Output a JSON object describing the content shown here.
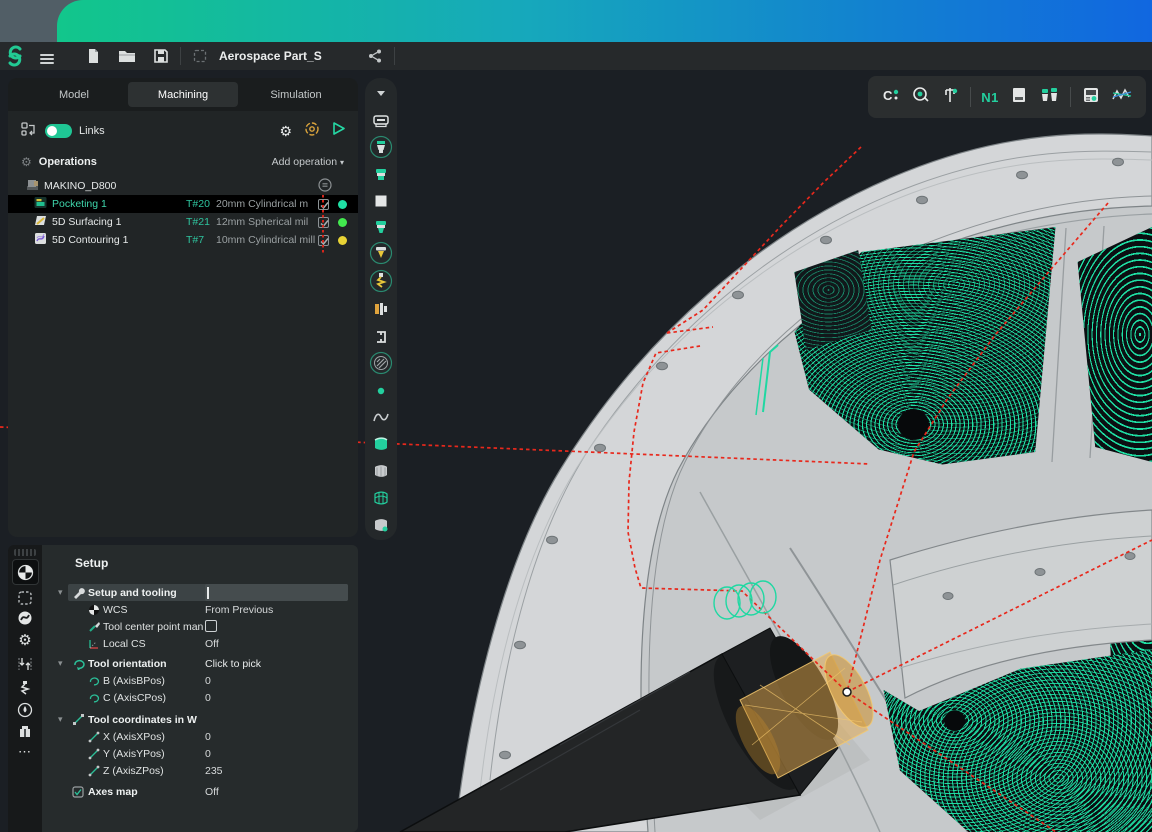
{
  "window": {
    "title": "Aerospace Part_S"
  },
  "topbar": {
    "icons": [
      "app-logo",
      "menu",
      "new-file",
      "open-folder",
      "save",
      "document-status",
      "share"
    ]
  },
  "tabs": {
    "items": [
      {
        "label": "Model"
      },
      {
        "label": "Machining"
      },
      {
        "label": "Simulation"
      }
    ],
    "active": "Machining"
  },
  "links": {
    "label": "Links",
    "enabled": true
  },
  "operations": {
    "header": "Operations",
    "add_button": "Add operation",
    "machine": "MAKINO_D800",
    "rows": [
      {
        "name": "Pocketing 1",
        "tool": "T#20",
        "description": "20mm Cylindrical m",
        "checked": true,
        "selected": true,
        "status_color": "#1fdfa4",
        "dot_style": "background:#1fdfa4"
      },
      {
        "name": "5D Surfacing 1",
        "tool": "T#21",
        "description": "12mm Spherical mil",
        "checked": true,
        "selected": false,
        "status_color": "#42e94e",
        "dot_style": "background:#42e94e"
      },
      {
        "name": "5D Contouring 1",
        "tool": "T#7",
        "description": "10mm Cylindrical mill",
        "checked": true,
        "selected": false,
        "status_color": "#e8d335",
        "dot_style": "background:#e8d335"
      }
    ]
  },
  "right_toolbar": {
    "nc_label": "N1",
    "icons": [
      "snap-magnet",
      "measure-tape",
      "caliper",
      "nc-program",
      "sheet-report",
      "tool-library",
      "machine-controller",
      "analysis-graph"
    ]
  },
  "mid_toolbar": {
    "icons": [
      "collapse-chevron",
      "stock-device",
      "tool-holder-circled",
      "tool-holder",
      "stock-square",
      "tool-teal",
      "drill-tip-circled",
      "drill-bit-circled",
      "clamp-fixture",
      "stock-bracket",
      "hatch-region-circled",
      "point-dot",
      "spline-curve",
      "surface-teal",
      "surface-gray",
      "surface-grid",
      "surface-point"
    ]
  },
  "setup_strip": {
    "icons": [
      "wcs",
      "stock-selection",
      "turning",
      "settings-gear",
      "travel-limits",
      "drill",
      "coolant",
      "tool-holder-block",
      "more"
    ]
  },
  "setup": {
    "title": "Setup",
    "groups": [
      {
        "label": "Setup and tooling",
        "value": "",
        "rows": [
          {
            "label": "WCS",
            "value": "From Previous"
          },
          {
            "label": "Tool center point man",
            "value": "",
            "checkbox": false
          },
          {
            "label": "Local CS",
            "value": "Off"
          }
        ]
      },
      {
        "label": "Tool orientation",
        "value": "Click to pick",
        "rows": [
          {
            "label": "B (AxisBPos)",
            "value": "0"
          },
          {
            "label": "C (AxisCPos)",
            "value": "0"
          }
        ]
      },
      {
        "label": "Tool coordinates in W",
        "value": "",
        "rows": [
          {
            "label": "X (AxisXPos)",
            "value": "0"
          },
          {
            "label": "Y (AxisYPos)",
            "value": "0"
          },
          {
            "label": "Z (AxisZPos)",
            "value": "235"
          }
        ]
      },
      {
        "label": "Axes map",
        "value": "Off",
        "rows": []
      }
    ]
  },
  "colors": {
    "accent_teal": "#1fd8a2",
    "toolpath_teal": "#20eba9",
    "rapid_red": "#e8281c",
    "tool_tan": "#e0a845",
    "status_green": "#42e94e",
    "status_yellow": "#e8d335",
    "gradient_left": "#12c68b",
    "gradient_right": "#1167e0",
    "selected_row": "#000000"
  }
}
